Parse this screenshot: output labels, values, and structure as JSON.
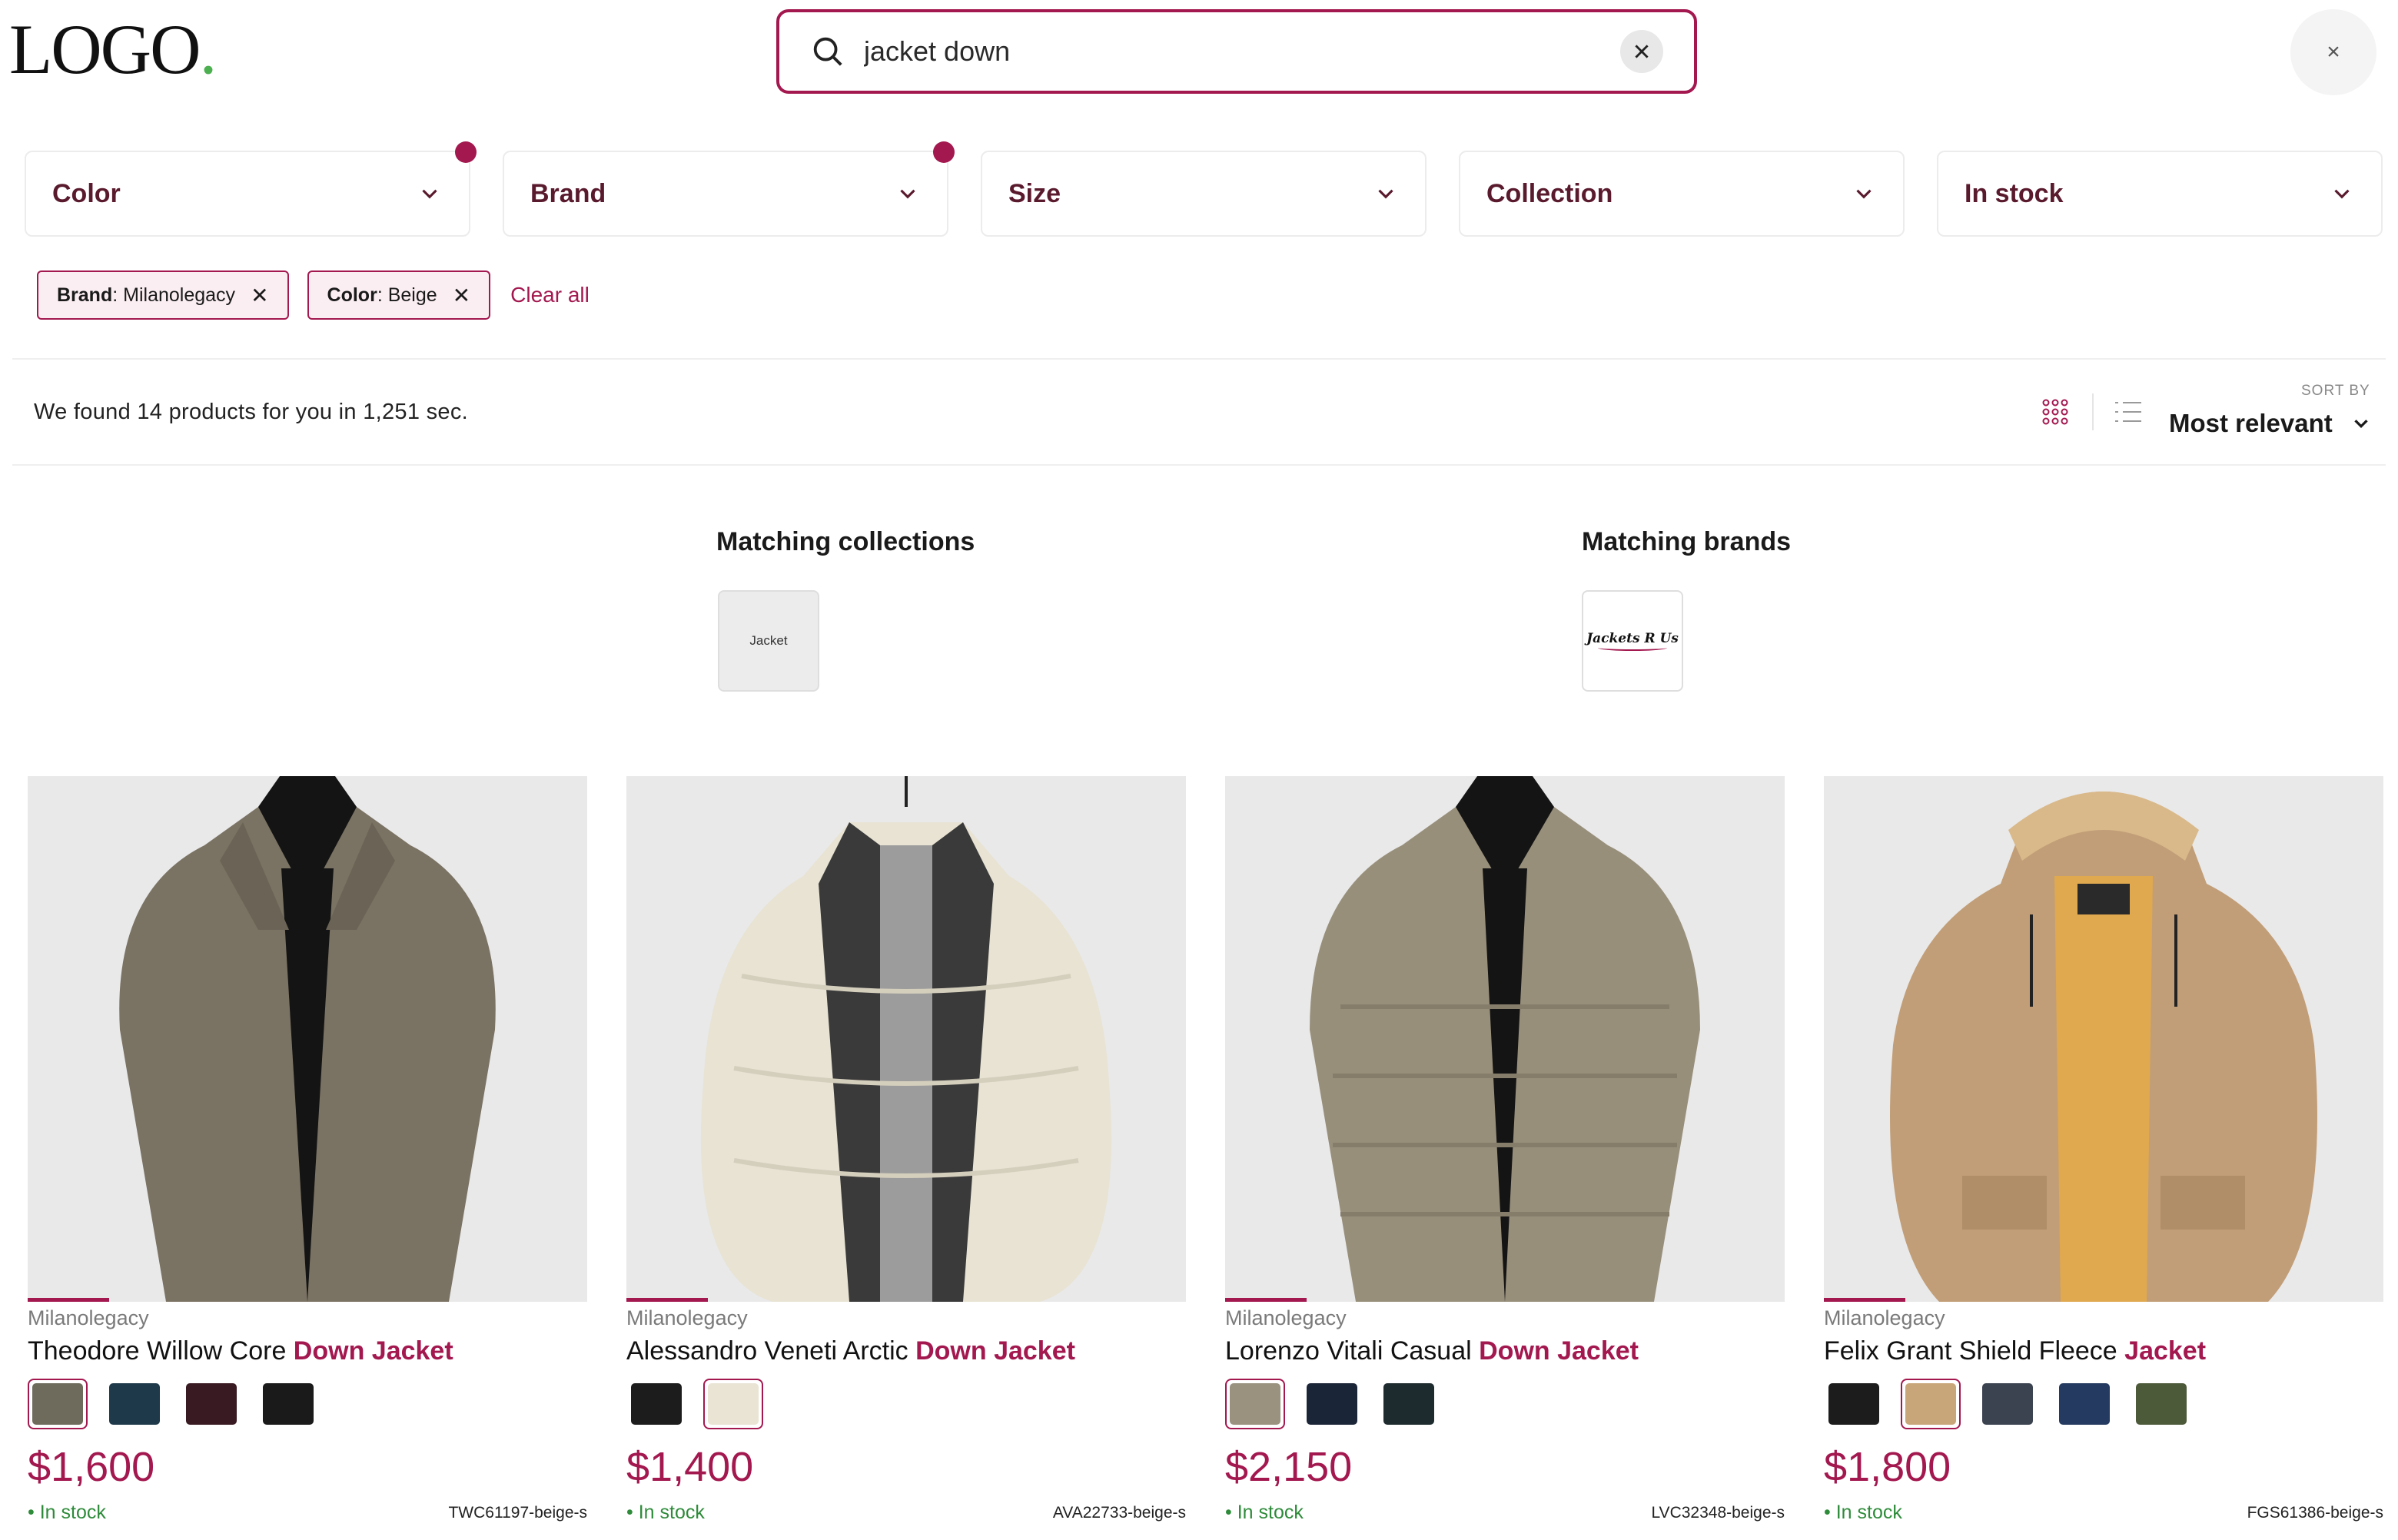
{
  "header": {
    "logo_text": "LOGO",
    "logo_dot": ".",
    "search_value": "jacket down",
    "close_label": "×"
  },
  "filters": [
    {
      "label": "Color",
      "active": true
    },
    {
      "label": "Brand",
      "active": true
    },
    {
      "label": "Size",
      "active": false
    },
    {
      "label": "Collection",
      "active": false
    },
    {
      "label": "In stock",
      "active": false
    }
  ],
  "active_filters": [
    {
      "key": "Brand",
      "value": "Milanolegacy"
    },
    {
      "key": "Color",
      "value": "Beige"
    }
  ],
  "clear_all_label": "Clear all",
  "results": {
    "text": "We found 14 products for you in 1,251 sec.",
    "sort_label": "SORT BY",
    "sort_value": "Most relevant"
  },
  "matching_collections": {
    "title": "Matching collections",
    "items": [
      "Jacket"
    ]
  },
  "matching_brands": {
    "title": "Matching brands",
    "items": [
      "Jackets R Us"
    ]
  },
  "products": [
    {
      "brand": "Milanolegacy",
      "title_plain": "Theodore Willow Core ",
      "title_hl": "Down Jacket",
      "price": "$1,600",
      "stock": "In stock",
      "sku": "TWC61197-beige-s",
      "swatches": [
        "#6e6a5c",
        "#1e3a4a",
        "#3a1a22",
        "#1a1a1a"
      ],
      "selected_swatch": 0,
      "jacket_color": "#7a7263"
    },
    {
      "brand": "Milanolegacy",
      "title_plain": "Alessandro Veneti Arctic ",
      "title_hl": "Down Jacket",
      "price": "$1,400",
      "stock": "In stock",
      "sku": "AVA22733-beige-s",
      "swatches": [
        "#1c1c1c",
        "#e9e4d4"
      ],
      "selected_swatch": 1,
      "jacket_color": "#e8e3d3"
    },
    {
      "brand": "Milanolegacy",
      "title_plain": "Lorenzo Vitali Casual ",
      "title_hl": "Down Jacket",
      "price": "$2,150",
      "stock": "In stock",
      "sku": "LVC32348-beige-s",
      "swatches": [
        "#9a927f",
        "#1b2538",
        "#1d2a2e"
      ],
      "selected_swatch": 0,
      "jacket_color": "#988f7b"
    },
    {
      "brand": "Milanolegacy",
      "title_plain": "Felix Grant Shield Fleece ",
      "title_hl": "Jacket",
      "price": "$1,800",
      "stock": "In stock",
      "sku": "FGS61386-beige-s",
      "swatches": [
        "#1c1c1c",
        "#c9a57a",
        "#3b4250",
        "#243a60",
        "#4d5a3a"
      ],
      "selected_swatch": 1,
      "jacket_color": "#c19e77"
    }
  ]
}
